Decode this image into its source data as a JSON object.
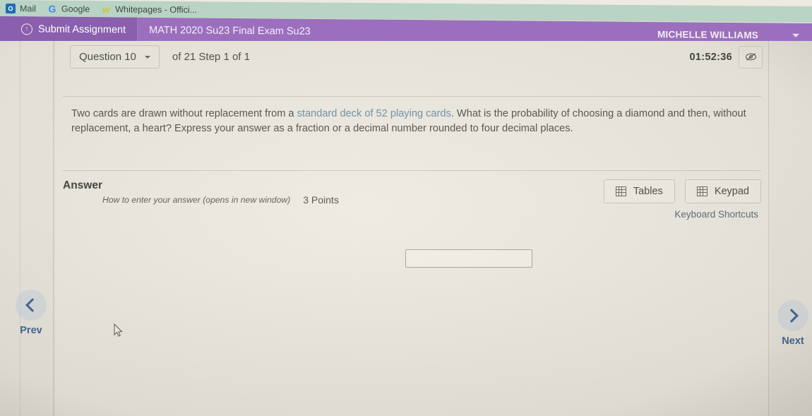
{
  "browser": {
    "bookmarks": [
      {
        "label": "Mail",
        "icon": "outlook-mail-icon"
      },
      {
        "label": "Google",
        "icon": "google-g-icon"
      },
      {
        "label": "Whitepages - Offici...",
        "icon": "whitepages-w-icon"
      }
    ]
  },
  "header": {
    "submit_label": "Submit Assignment",
    "submit_icon": "circle-up-arrow-icon",
    "course_title": "MATH 2020 Su23 Final Exam Su23",
    "user_name": "MICHELLE WILLIAMS",
    "user_caret_icon": "caret-down-icon",
    "accent_color": "#9b6fbd"
  },
  "question_bar": {
    "question_selector": "Question 10",
    "selector_caret_icon": "caret-down-icon",
    "step_text": "of 21 Step 1 of 1",
    "timer": "01:52:36",
    "timer_toggle_icon": "eye-slash-icon"
  },
  "question": {
    "text_before_link": "Two cards are drawn without replacement from a ",
    "link_text": "standard deck of 52 playing cards",
    "text_after_link": ". What is the probability of choosing a diamond and then, without replacement, a heart? Express your answer as a fraction or a decimal number rounded to four decimal places.",
    "link_color": "#6e8fa8"
  },
  "answer": {
    "label": "Answer",
    "help_link": "How to enter your answer (opens in new window)",
    "points": "3 Points",
    "input_value": "",
    "input_placeholder": ""
  },
  "tools": {
    "tables_label": "Tables",
    "tables_icon": "table-grid-icon",
    "keypad_label": "Keypad",
    "keypad_icon": "keypad-grid-icon",
    "keyboard_shortcuts_label": "Keyboard Shortcuts"
  },
  "navigation": {
    "prev_label": "Prev",
    "prev_icon": "chevron-left-icon",
    "next_label": "Next",
    "next_icon": "chevron-right-icon",
    "nav_color": "#3a628f"
  }
}
